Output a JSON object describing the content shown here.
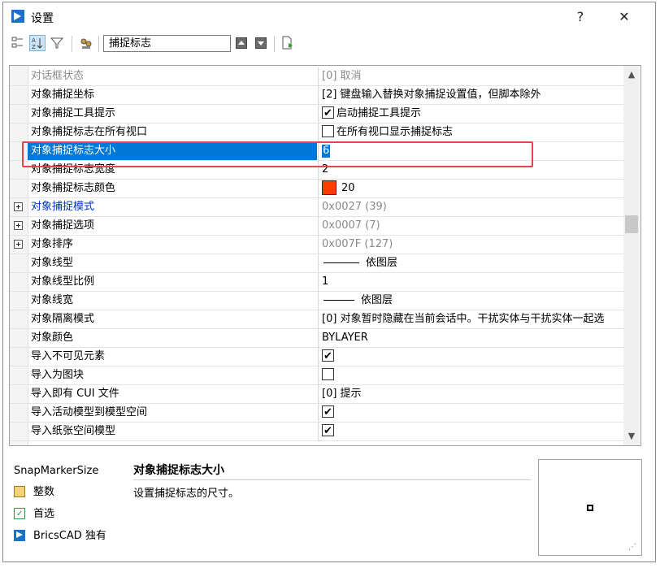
{
  "window": {
    "title": "设置",
    "help_label": "?",
    "close_label": "✕"
  },
  "toolbar": {
    "search_value": "捕捉标志"
  },
  "grid": {
    "rows": [
      {
        "name": "对话框状态",
        "value": "[0] 取消"
      },
      {
        "name": "对象捕捉坐标",
        "value": "[2] 键盘输入替换对象捕捉设置值，但脚本除外"
      },
      {
        "name": "对象捕捉工具提示",
        "value": "启动捕捉工具提示"
      },
      {
        "name": "对象捕捉标志在所有视口",
        "value": "在所有视口显示捕捉标志"
      },
      {
        "name": "对象捕捉标志大小",
        "value": "6"
      },
      {
        "name": "对象捕捉标志宽度",
        "value": "2"
      },
      {
        "name": "对象捕捉标志颜色",
        "value": "20"
      },
      {
        "name": "对象捕捉模式",
        "value": "0x0027 (39)"
      },
      {
        "name": "对象捕捉选项",
        "value": "0x0007 (7)"
      },
      {
        "name": "对象排序",
        "value": "0x007F (127)"
      },
      {
        "name": "对象线型",
        "value": "依图层"
      },
      {
        "name": "对象线型比例",
        "value": "1"
      },
      {
        "name": "对象线宽",
        "value": "依图层"
      },
      {
        "name": "对象隔离模式",
        "value": "[0] 对象暂时隐藏在当前会话中。干扰实体与干扰实体一起选"
      },
      {
        "name": "对象颜色",
        "value": "BYLAYER"
      },
      {
        "name": "导入不可见元素",
        "value": ""
      },
      {
        "name": "导入为图块",
        "value": ""
      },
      {
        "name": "导入即有 CUI 文件",
        "value": "[0] 提示"
      },
      {
        "name": "导入活动模型到模型空间",
        "value": ""
      },
      {
        "name": "导入纸张空间模型",
        "value": ""
      }
    ]
  },
  "description": {
    "key": "SnapMarkerSize",
    "type_label": "整数",
    "category_label": "首选",
    "product_label": "BricsCAD 独有",
    "title": "对象捕捉标志大小",
    "text": "设置捕捉标志的尺寸。"
  },
  "colors": {
    "selection": "#0078d7",
    "highlight_box": "#e8434b",
    "snap_color_swatch": "#ff3b00",
    "category_link": "#0033cc"
  },
  "icons": [
    "app-logo-icon",
    "categorized-view-icon",
    "alphabetical-sort-icon",
    "filter-icon",
    "search-settings-icon",
    "find-previous-icon",
    "find-next-icon",
    "export-icon",
    "integer-type-icon",
    "preference-icon",
    "bricscad-icon"
  ]
}
